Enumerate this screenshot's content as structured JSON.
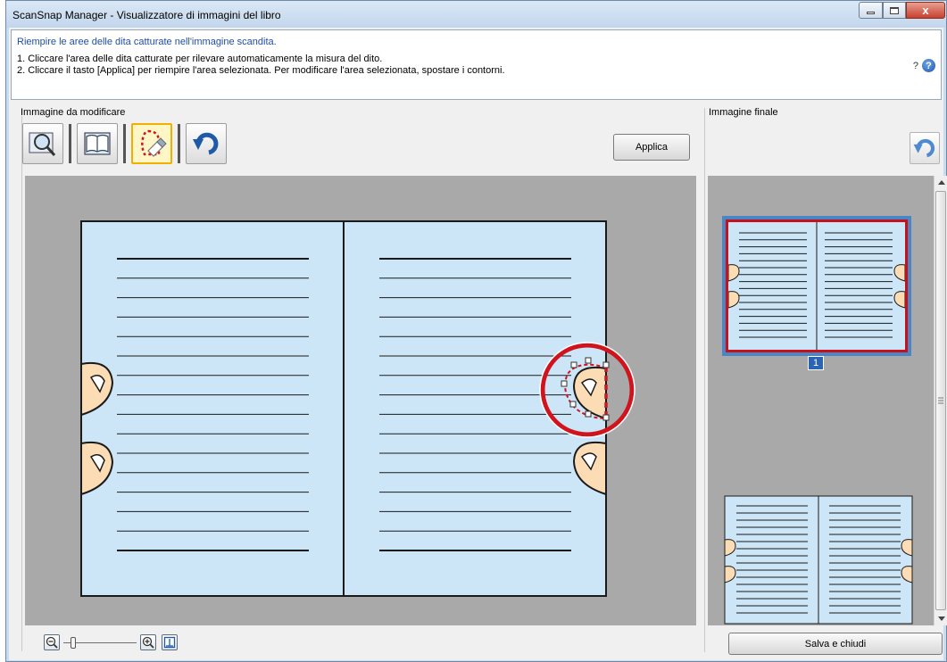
{
  "window": {
    "title": "ScanSnap Manager - Visualizzatore di immagini del libro",
    "minimize_glyph": "–",
    "maximize_glyph": "□",
    "close_glyph": "x"
  },
  "instructions": {
    "title": "Riempire le aree delle dita catturate nell'immagine scandita.",
    "line1": "1. Cliccare l'area delle dita catturate per rilevare automaticamente la misura del dito.",
    "line2": "2. Cliccare il tasto [Applica] per riempire l'area selezionata. Per modificare l'area selezionata, spostare i contorni.",
    "help_label": "?",
    "help_icon": "question-icon"
  },
  "left_panel": {
    "label": "Immagine da modificare",
    "tools": [
      {
        "name": "view-finder-icon",
        "selected": false
      },
      {
        "name": "book-crop-icon",
        "selected": false
      },
      {
        "name": "finger-fill-icon",
        "selected": true
      },
      {
        "name": "undo-icon",
        "selected": false
      }
    ],
    "apply_label": "Applica",
    "zoom": {
      "level": 0.1,
      "zoom_out_icon": "zoom-out-icon",
      "zoom_in_icon": "zoom-in-icon",
      "fit_icon": "fit-page-icon"
    }
  },
  "right_panel": {
    "label": "Immagine finale",
    "undo_icon": "undo-icon",
    "thumbnails": [
      {
        "page": "1",
        "selected": true
      },
      {
        "page": "",
        "selected": false
      }
    ],
    "save_label": "Salva e chiudi"
  },
  "colors": {
    "page_fill": "#cde6f7",
    "highlight_red": "#d0141e",
    "selected_thumb_border": "#4a86c6",
    "finger_fill": "#fbdcb4"
  }
}
